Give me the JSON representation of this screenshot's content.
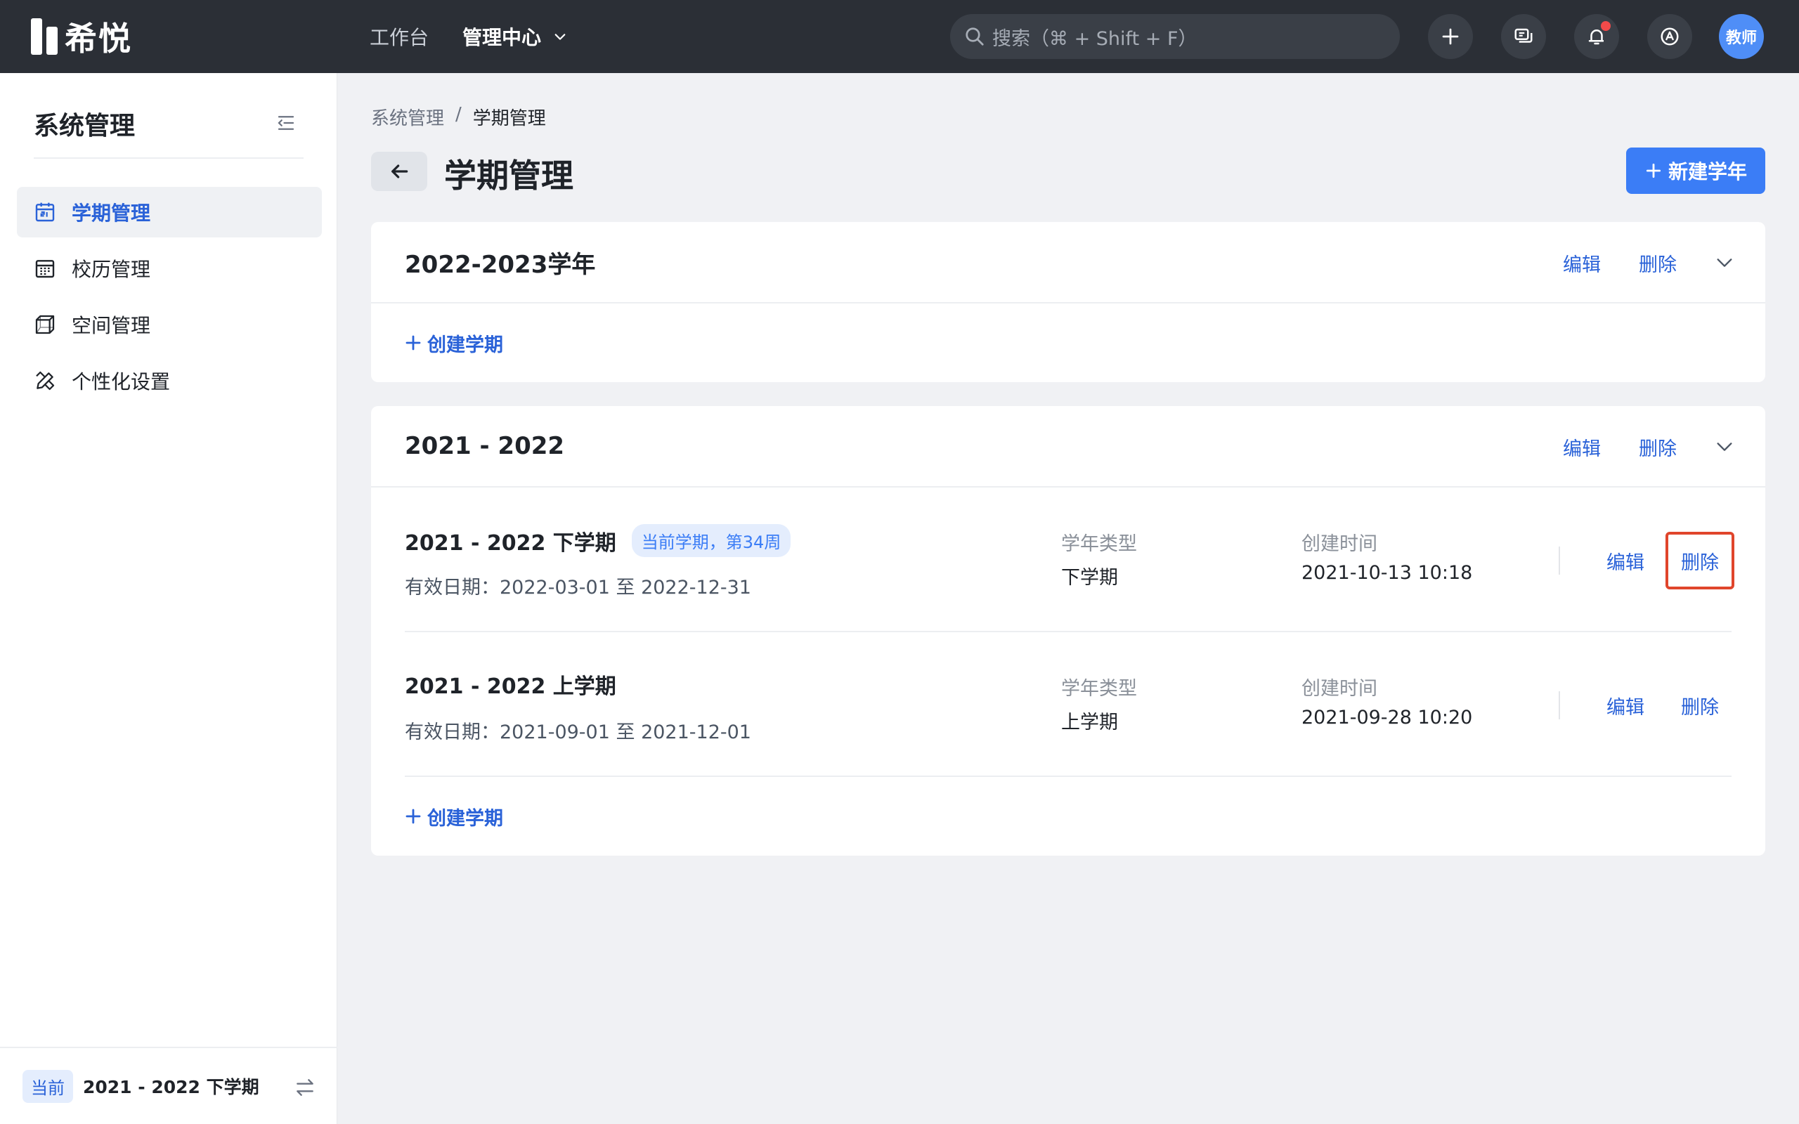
{
  "app": {
    "logo_text": "希悦"
  },
  "topnav": [
    {
      "label": "工作台",
      "active": false
    },
    {
      "label": "管理中心",
      "active": true
    }
  ],
  "search": {
    "placeholder": "搜索（⌘ + Shift + F）"
  },
  "user": {
    "avatar_label": "教师"
  },
  "sidebar": {
    "title": "系统管理",
    "items": [
      {
        "label": "学期管理",
        "icon": "calendar-icon",
        "active": true
      },
      {
        "label": "校历管理",
        "icon": "calendar-grid-icon",
        "active": false
      },
      {
        "label": "空间管理",
        "icon": "cube-icon",
        "active": false
      },
      {
        "label": "个性化设置",
        "icon": "pencil-ruler-icon",
        "active": false
      }
    ],
    "footer": {
      "tag": "当前",
      "term": "2021 - 2022 下学期"
    }
  },
  "breadcrumb": {
    "parent": "系统管理",
    "separator": "/",
    "current": "学期管理"
  },
  "page": {
    "title": "学期管理",
    "new_year_button": "新建学年"
  },
  "years": [
    {
      "title": "2022-2023学年",
      "edit": "编辑",
      "delete": "删除",
      "create_term": "创建学期",
      "terms": []
    },
    {
      "title": "2021 - 2022",
      "edit": "编辑",
      "delete": "删除",
      "create_term": "创建学期",
      "terms": [
        {
          "name": "2021 - 2022 下学期",
          "badge": "当前学期，第34周",
          "date": "有效日期：2022-03-01 至 2022-12-31",
          "type_label": "学年类型",
          "type_value": "下学期",
          "created_label": "创建时间",
          "created_value": "2021-10-13 10:18",
          "edit": "编辑",
          "delete": "删除"
        },
        {
          "name": "2021 - 2022 上学期",
          "badge": "",
          "date": "有效日期：2021-09-01 至 2021-12-01",
          "type_label": "学年类型",
          "type_value": "上学期",
          "created_label": "创建时间",
          "created_value": "2021-09-28 10:20",
          "edit": "编辑",
          "delete": "删除"
        }
      ]
    }
  ],
  "colors": {
    "topbar": "#2b2f36",
    "accent": "#3b7df6",
    "link": "#2a62d8",
    "highlight": "#e0452b"
  }
}
